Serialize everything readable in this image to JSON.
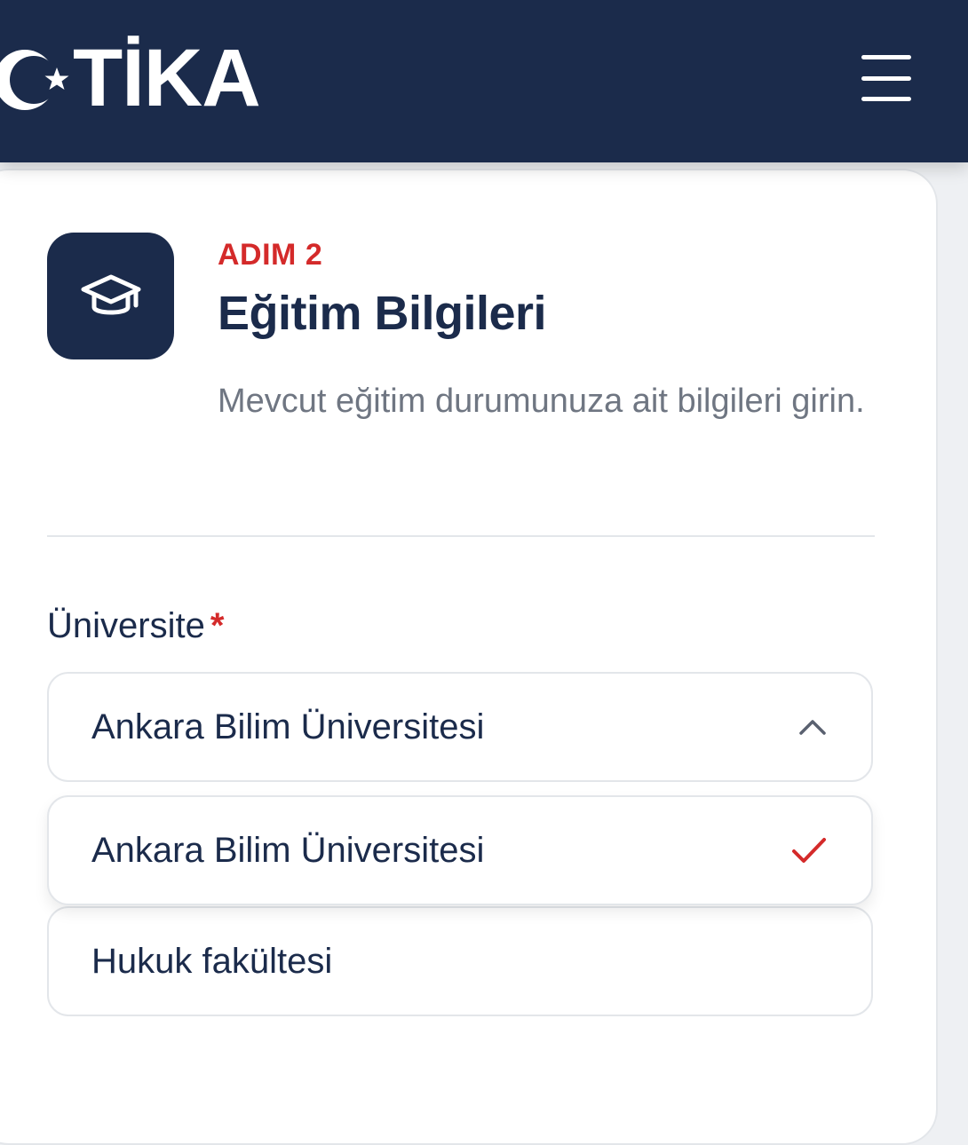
{
  "header": {
    "logo_text": "TİKA",
    "menu_icon": "hamburger-menu-icon"
  },
  "step": {
    "icon": "graduation-cap-icon",
    "label": "ADIM 2",
    "title": "Eğitim Bilgileri",
    "description": "Mevcut eğitim durumunuza ait bilgileri girin."
  },
  "form": {
    "university": {
      "label": "Üniversite",
      "required_marker": "*",
      "value": "Ankara Bilim Üniversitesi",
      "options": [
        {
          "label": "Ankara Bilim Üniversitesi",
          "selected": true
        },
        {
          "label": "Hukuk fakültesi",
          "selected": false
        }
      ]
    }
  },
  "colors": {
    "navy": "#1b2b4b",
    "accent_red": "#d42a2a",
    "muted_text": "#6f7682"
  }
}
